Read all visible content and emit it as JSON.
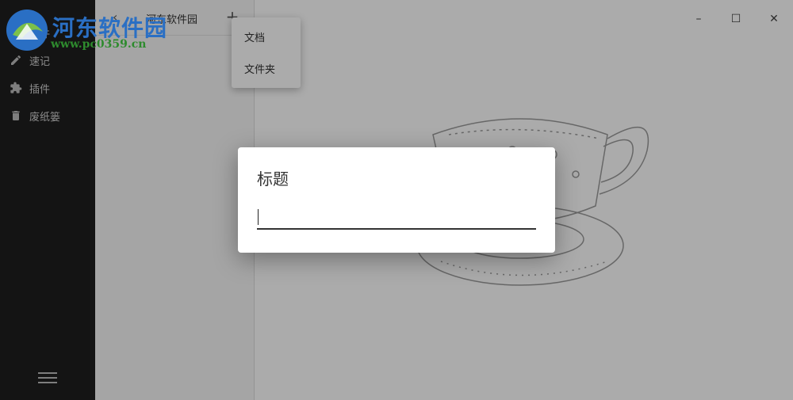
{
  "sidebar": {
    "top_item": {
      "label": "文件",
      "icon": "folder-icon"
    },
    "items": [
      {
        "label": "速记",
        "icon": "pencil-icon"
      },
      {
        "label": "插件",
        "icon": "puzzle-icon"
      },
      {
        "label": "废纸篓",
        "icon": "trash-icon"
      }
    ],
    "menu_icon": "hamburger-icon"
  },
  "list": {
    "back_glyph": "‹",
    "folder_title": "河东软件园",
    "add_glyph": "+"
  },
  "dropdown": {
    "items": [
      "文档",
      "文件夹"
    ]
  },
  "window_controls": {
    "minimize": "–",
    "maximize": "☐",
    "close": "✕"
  },
  "dialog": {
    "title": "标题",
    "input_value": ""
  },
  "watermark": {
    "name": "河东软件园",
    "url": "www.pc0359.cn"
  },
  "colors": {
    "sidebar_bg": "#1f1f1f",
    "watermark_blue": "#2a6fc4",
    "watermark_green": "#2e8b2e"
  }
}
